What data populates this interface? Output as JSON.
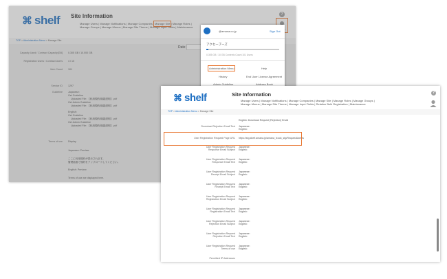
{
  "shot1": {
    "logo": "shelf",
    "title": "Site Information",
    "nav": [
      "Manage Users",
      "Manage Notifications",
      "Manage Companies",
      "Manage Site",
      "Manage Roles",
      "Manage Groups",
      "Manage Menus",
      "Manage Site Theme",
      "Manage Input Fields",
      "Maintenance"
    ],
    "help": "?",
    "breadcrumb": [
      "TOP",
      "Administration Menu",
      "Manage Site"
    ],
    "date_label": "Date",
    "rows": [
      {
        "label": "Capacity Used / Contract Capacity[GB]",
        "value": "0.305 GB / 10.000 GB"
      },
      {
        "label": "Registration Users / Contract Users",
        "value": "4 / 10"
      },
      {
        "label": "Item Count",
        "value": "101"
      },
      {
        "label": "Service ID",
        "value": "1297"
      },
      {
        "label": "Guideline",
        "value": "Japanese:"
      },
      {
        "label": "",
        "value": "Get Guideline"
      },
      {
        "label": "",
        "value": "Uploaded File: 【利用規約/機能説明】.pdf"
      },
      {
        "label": "",
        "value": "Get Admin Guideline"
      },
      {
        "label": "",
        "value": "Uploaded File: 【利用規約/機能説明】.pdf"
      },
      {
        "label": "",
        "value": "English:"
      },
      {
        "label": "",
        "value": "Get Guideline"
      },
      {
        "label": "",
        "value": "Uploaded File: 【利用規約/機能説明】.pdf"
      },
      {
        "label": "",
        "value": "Get Admin Guideline"
      },
      {
        "label": "",
        "value": "Uploaded File: 【利用規約/機能説明】.pdf"
      },
      {
        "label": "Terms of use",
        "value": "Display"
      },
      {
        "label": "",
        "value": "Japanese:    Preview"
      },
      {
        "label": "",
        "value": "ここに利用規約が表示されます。"
      },
      {
        "label": "",
        "value": "管理画面で規約をアップロードしてください。"
      },
      {
        "label": "",
        "value": "English:    Preview"
      },
      {
        "label": "",
        "value": "Terms of use are displayed here."
      }
    ],
    "menu": {
      "email": "@amana.co.jp",
      "signout": "Sign Out",
      "plan": "アクセーブーズ",
      "usage": "0.305 GB / 10 GB  Contents Count:101  Users",
      "items": [
        "Administration Menu",
        "Help",
        "History",
        "End User License Agreement",
        "Admin Guideline",
        "Address Book"
      ]
    }
  },
  "shot2": {
    "logo": "shelf",
    "title": "Site Information",
    "nav": [
      "Manage Users",
      "Manage Notifications",
      "Manage Companies",
      "Manage Site",
      "Manage Roles",
      "Manage Groups",
      "Manage Menus",
      "Manage Site Theme",
      "Manage Input Fields",
      "Relation Bulk Registration",
      "Maintenance"
    ],
    "help": "?",
    "breadcrumb": [
      "TOP",
      "Administration Menu",
      "Manage Site"
    ],
    "top_text": "English: Download Request  [Rejection]  Email",
    "rows": [
      {
        "l1": "Download Rejection Email Text",
        "l2": "",
        "v1": "Japanese:",
        "v2": "English:"
      },
      {
        "l1": "User Registration Request Page URL",
        "l2": "",
        "v1": "https://stg.shelf.amana.jp/amana_fcook_stg/RequestUser.ts",
        "v2": ""
      },
      {
        "l1": "User Registration Request",
        "l2": "Response Email Subject",
        "v1": "Japanese:",
        "v2": "English:"
      },
      {
        "l1": "User Registration Request",
        "l2": "Response Email Text",
        "v1": "Japanese:",
        "v2": "English:"
      },
      {
        "l1": "User Registration Request",
        "l2": "Receipt Email Subject",
        "v1": "Japanese:",
        "v2": "English:"
      },
      {
        "l1": "User Registration Request",
        "l2": "Receipt Email Text",
        "v1": "Japanese:",
        "v2": "English:"
      },
      {
        "l1": "User Registration Request",
        "l2": "Registration Email Subject",
        "v1": "Japanese:",
        "v2": "English:"
      },
      {
        "l1": "User Registration Request",
        "l2": "Registration Email Text",
        "v1": "Japanese:",
        "v2": "English:"
      },
      {
        "l1": "User Registration Request",
        "l2": "Rejection Email Subject",
        "v1": "Japanese:",
        "v2": "English:"
      },
      {
        "l1": "User Registration Request",
        "l2": "Rejection Email Text",
        "v1": "Japanese:",
        "v2": "English:"
      },
      {
        "l1": "User Registration Request",
        "l2": "Terms of use",
        "v1": "Japanese:",
        "v2": "English:"
      },
      {
        "l1": "Permitted IP Addresses",
        "l2": "",
        "v1": "",
        "v2": ""
      }
    ]
  },
  "colors": {
    "accent": "#e8732c",
    "brand": "#1e6fc2"
  }
}
